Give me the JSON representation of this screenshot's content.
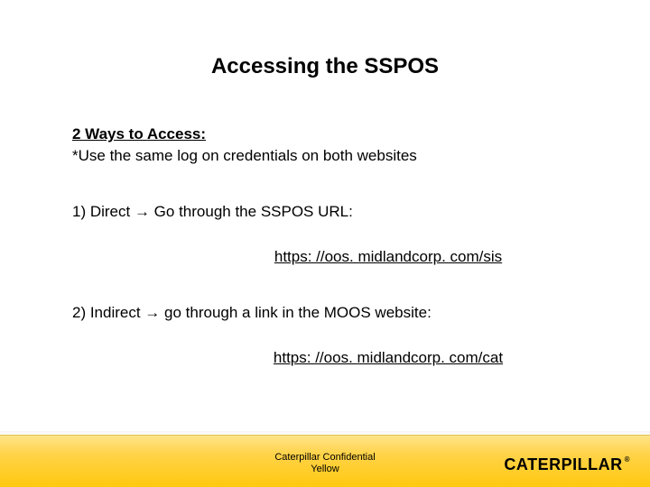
{
  "title": "Accessing the SSPOS",
  "heading": "2 Ways to Access:",
  "note": "*Use the same log on credentials on both websites",
  "item1": "1) Direct → Go through the SSPOS URL:",
  "link1": "https: //oos. midlandcorp. com/sis",
  "item2": "2) Indirect → go through a link in the MOOS website:",
  "link2": "https: //oos. midlandcorp. com/cat",
  "confidential_line1": "Caterpillar Confidential",
  "confidential_line2": "Yellow",
  "logo_text": "CATERPILLAR",
  "logo_reg": "®"
}
